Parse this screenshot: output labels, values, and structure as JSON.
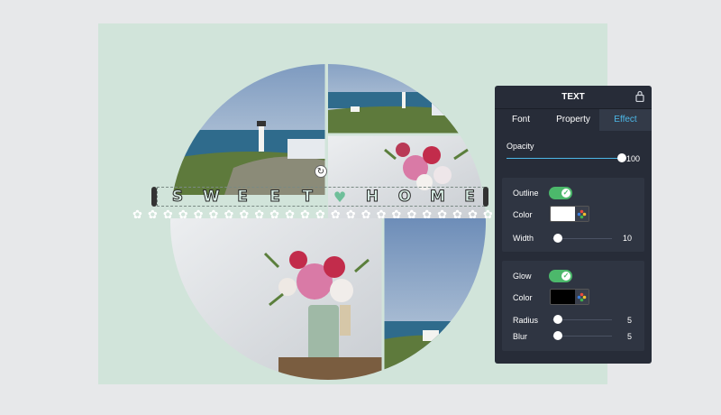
{
  "canvas": {
    "background": "#d1e4da",
    "text_letters": [
      "S",
      "W",
      "E",
      "E",
      "T",
      "♥",
      "H",
      "O",
      "M",
      "E"
    ],
    "daisy_glyph": "✿",
    "daisy_count": 24
  },
  "panel": {
    "title": "TEXT",
    "tabs": [
      {
        "label": "Font",
        "active": false
      },
      {
        "label": "Property",
        "active": false
      },
      {
        "label": "Effect",
        "active": true
      }
    ],
    "opacity": {
      "label": "Opacity",
      "value": "100",
      "level": 1.0
    },
    "outline": {
      "label": "Outline",
      "enabled": true,
      "color_label": "Color",
      "color": "#ffffff",
      "width_label": "Width",
      "width_value": "10",
      "width_level": 0.0
    },
    "glow": {
      "label": "Glow",
      "enabled": true,
      "color_label": "Color",
      "color": "#000000",
      "radius_label": "Radius",
      "radius_value": "5",
      "radius_level": 0.0,
      "blur_label": "Blur",
      "blur_value": "5",
      "blur_level": 0.0
    },
    "accent": "#4db8e8",
    "toggle_color": "#4cb86b"
  }
}
